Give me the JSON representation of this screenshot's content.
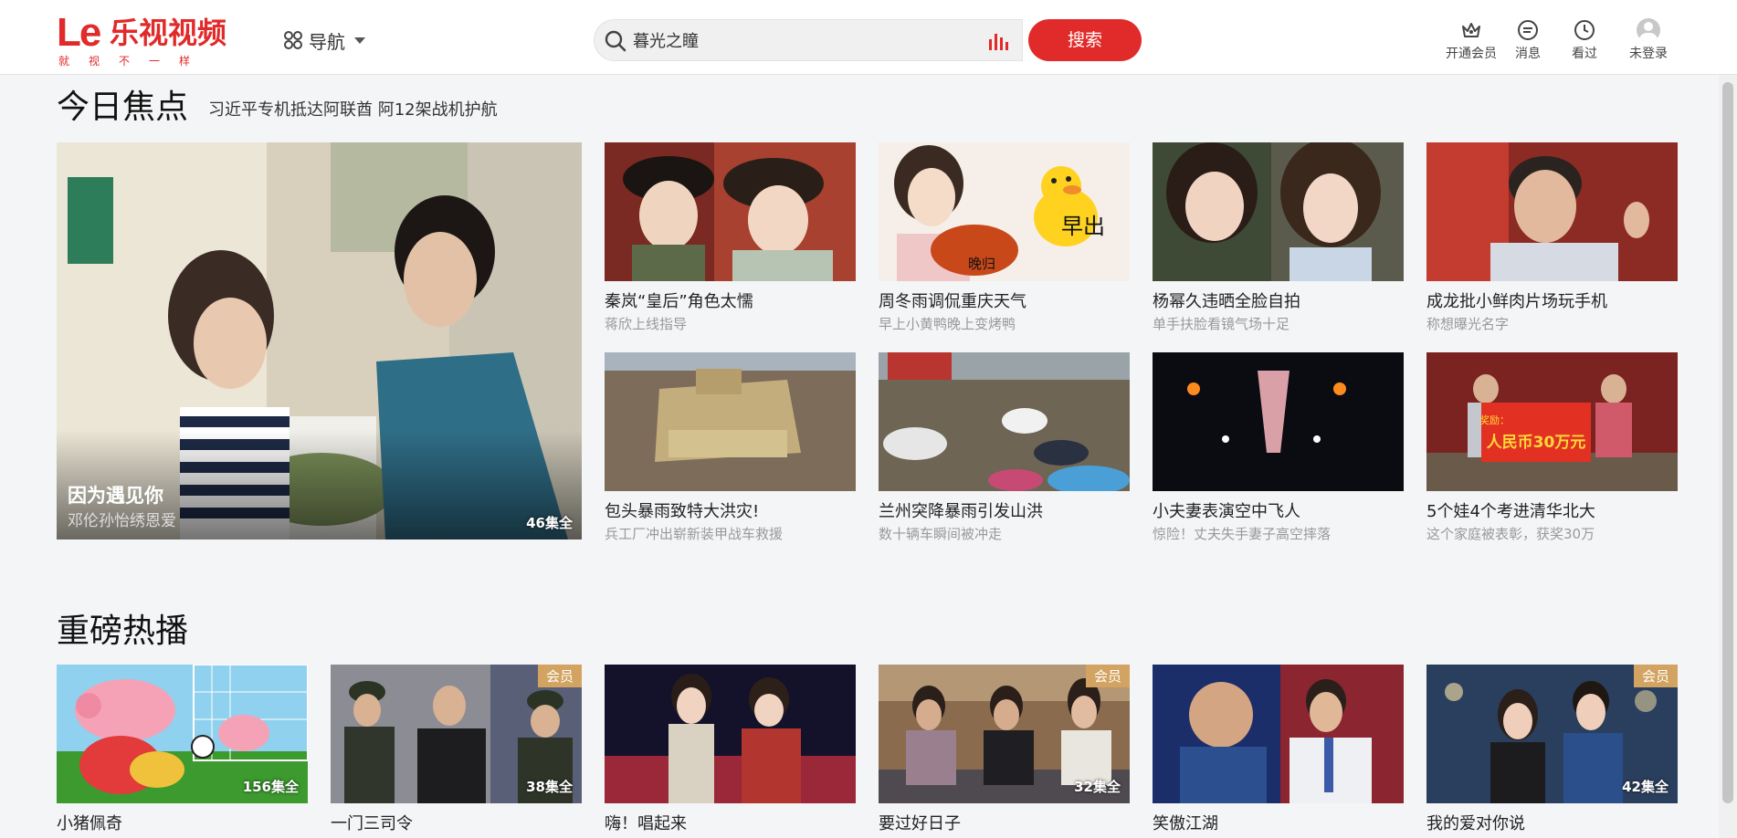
{
  "brand": {
    "logo_mark": "Le",
    "name": "乐视视频",
    "slogan": "就视不一样",
    "color": "#e12a2a"
  },
  "nav": {
    "label": "导航"
  },
  "search": {
    "query": "暮光之瞳",
    "button": "搜索"
  },
  "user_tools": [
    {
      "label": "开通会员",
      "icon": "crown-icon"
    },
    {
      "label": "消息",
      "icon": "message-icon"
    },
    {
      "label": "看过",
      "icon": "clock-icon"
    },
    {
      "label": "未登录",
      "icon": "avatar-icon"
    }
  ],
  "focus": {
    "title": "今日焦点",
    "subtitle": "习近平专机抵达阿联酋 阿12架战机护航",
    "big": {
      "title": "因为遇见你",
      "sub": "邓伦孙怡绣恩爱",
      "episodes": "46集全"
    },
    "items": [
      {
        "title": "秦岚“皇后”角色太懦",
        "sub": "蒋欣上线指导"
      },
      {
        "title": "周冬雨调侃重庆天气",
        "sub": "早上小黄鸭晚上变烤鸭",
        "overlay_a": "早出",
        "overlay_b": "晚归"
      },
      {
        "title": "杨幂久违晒全脸自拍",
        "sub": "单手扶脸看镜气场十足"
      },
      {
        "title": "成龙批小鲜肉片场玩手机",
        "sub": "称想曝光名字"
      },
      {
        "title": "包头暴雨致特大洪灾!",
        "sub": "兵工厂冲出崭新装甲战车救援"
      },
      {
        "title": "兰州突降暴雨引发山洪",
        "sub": "数十辆车瞬间被冲走"
      },
      {
        "title": "小夫妻表演空中飞人",
        "sub": "惊险！丈夫失手妻子高空摔落"
      },
      {
        "title": "5个娃4个考进清华北大",
        "sub": "这个家庭被表彰，获奖30万",
        "banner_small": "奖励：",
        "banner": "人民币30万元"
      }
    ]
  },
  "hot": {
    "title": "重磅热播",
    "items": [
      {
        "title": "小猪佩奇",
        "episodes": "156集全",
        "vip": ""
      },
      {
        "title": "一门三司令",
        "episodes": "38集全",
        "vip": "会员"
      },
      {
        "title": "嗨！唱起来",
        "episodes": "",
        "vip": ""
      },
      {
        "title": "要过好日子",
        "episodes": "32集全",
        "vip": "会员"
      },
      {
        "title": "笑傲江湖",
        "episodes": "",
        "vip": ""
      },
      {
        "title": "我的爱对你说",
        "episodes": "42集全",
        "vip": "会员"
      }
    ]
  }
}
